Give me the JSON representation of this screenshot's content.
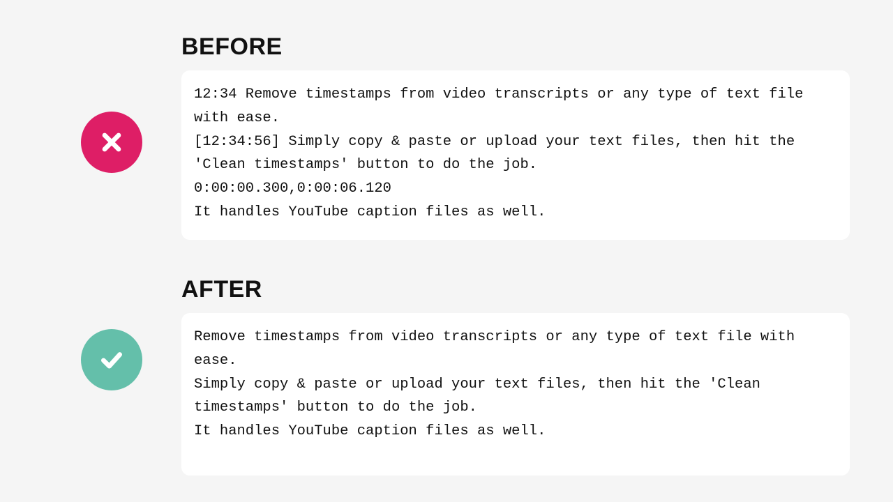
{
  "before": {
    "heading": "BEFORE",
    "lines": [
      "12:34 Remove timestamps from video transcripts or any type of text file with ease.",
      "[12:34:56] Simply copy & paste or upload your text files, then hit the 'Clean timestamps' button to do the job.",
      "0:00:00.300,0:00:06.120",
      "It handles YouTube caption files as well."
    ]
  },
  "after": {
    "heading": "AFTER",
    "lines": [
      "Remove timestamps from video transcripts or any type of text file with ease.",
      "Simply copy & paste or upload your text files, then hit the 'Clean timestamps' button to do the job.",
      "It handles YouTube caption files as well."
    ]
  },
  "colors": {
    "error": "#de1e66",
    "success": "#64bfaa",
    "page_bg": "#f5f5f5",
    "card_bg": "#ffffff"
  }
}
